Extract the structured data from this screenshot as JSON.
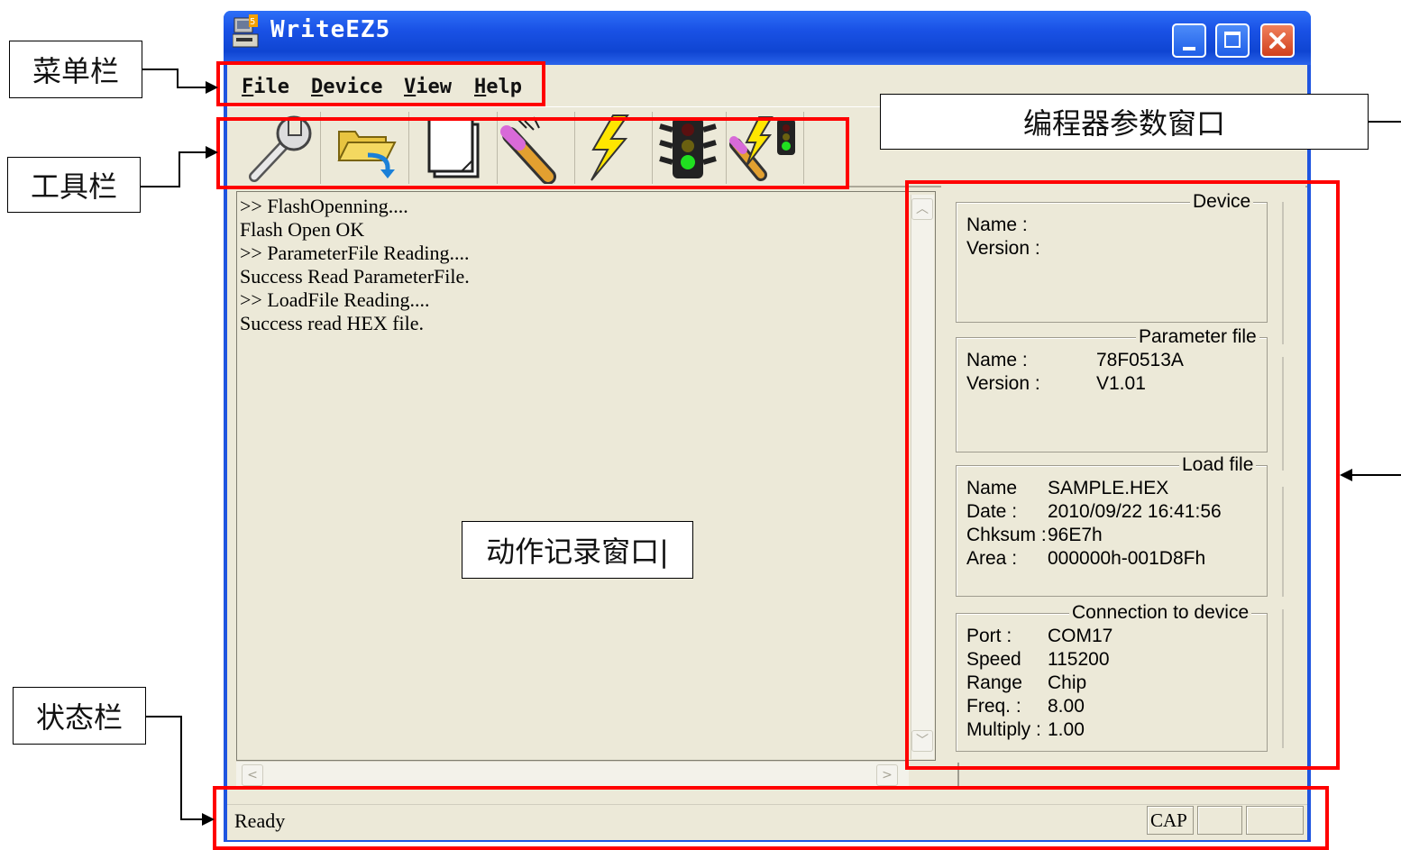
{
  "window": {
    "title": "WriteEZ5",
    "controls": {
      "minimize": "minimize",
      "maximize": "maximize",
      "close": "close"
    }
  },
  "menu": [
    "File",
    "Device",
    "View",
    "Help"
  ],
  "toolbar": {
    "icons": [
      "wrench-icon",
      "open-file-icon",
      "blank-page-icon",
      "erase-pencil-icon",
      "lightning-program-icon",
      "traffic-light-verify-icon",
      "autoprocedure-icon"
    ]
  },
  "log": {
    "lines": [
      ">> FlashOpenning....",
      "Flash Open OK",
      ">> ParameterFile Reading....",
      "Success Read ParameterFile.",
      ">> LoadFile Reading....",
      "Success read HEX file."
    ]
  },
  "panel": {
    "device": {
      "title": "Device",
      "name_label": "Name :",
      "version_label": "Version :"
    },
    "parameter_file": {
      "title": "Parameter file",
      "name_label": "Name :",
      "name_value": "78F0513A",
      "version_label": "Version :",
      "version_value": "V1.01"
    },
    "load_file": {
      "title": "Load file",
      "name_label": "Name",
      "name_value": "SAMPLE.HEX",
      "date_label": "Date :",
      "date_value": "2010/09/22 16:41:56",
      "chksum_label": "Chksum :",
      "chksum_value": "96E7h",
      "area_label": "Area :",
      "area_value": "000000h-001D8Fh"
    },
    "connection": {
      "title": "Connection to device",
      "port_label": "Port :",
      "port_value": "COM17",
      "speed_label": "Speed",
      "speed_value": "115200",
      "range_label": "Range",
      "range_value": "Chip",
      "freq_label": "Freq. :",
      "freq_value": "8.00",
      "multiply_label": "Multiply :",
      "multiply_value": "1.00"
    }
  },
  "status": {
    "text": "Ready",
    "cap": "CAP"
  },
  "annotations": {
    "menubar": "菜单栏",
    "toolbar": "工具栏",
    "statusbar": "状态栏",
    "param_window": "编程器参数窗口",
    "log_window": "动作记录窗口|"
  },
  "colors": {
    "highlight": "#ff0000",
    "titlebar": "#1a52e6",
    "window_bg": "#ece9d8"
  }
}
